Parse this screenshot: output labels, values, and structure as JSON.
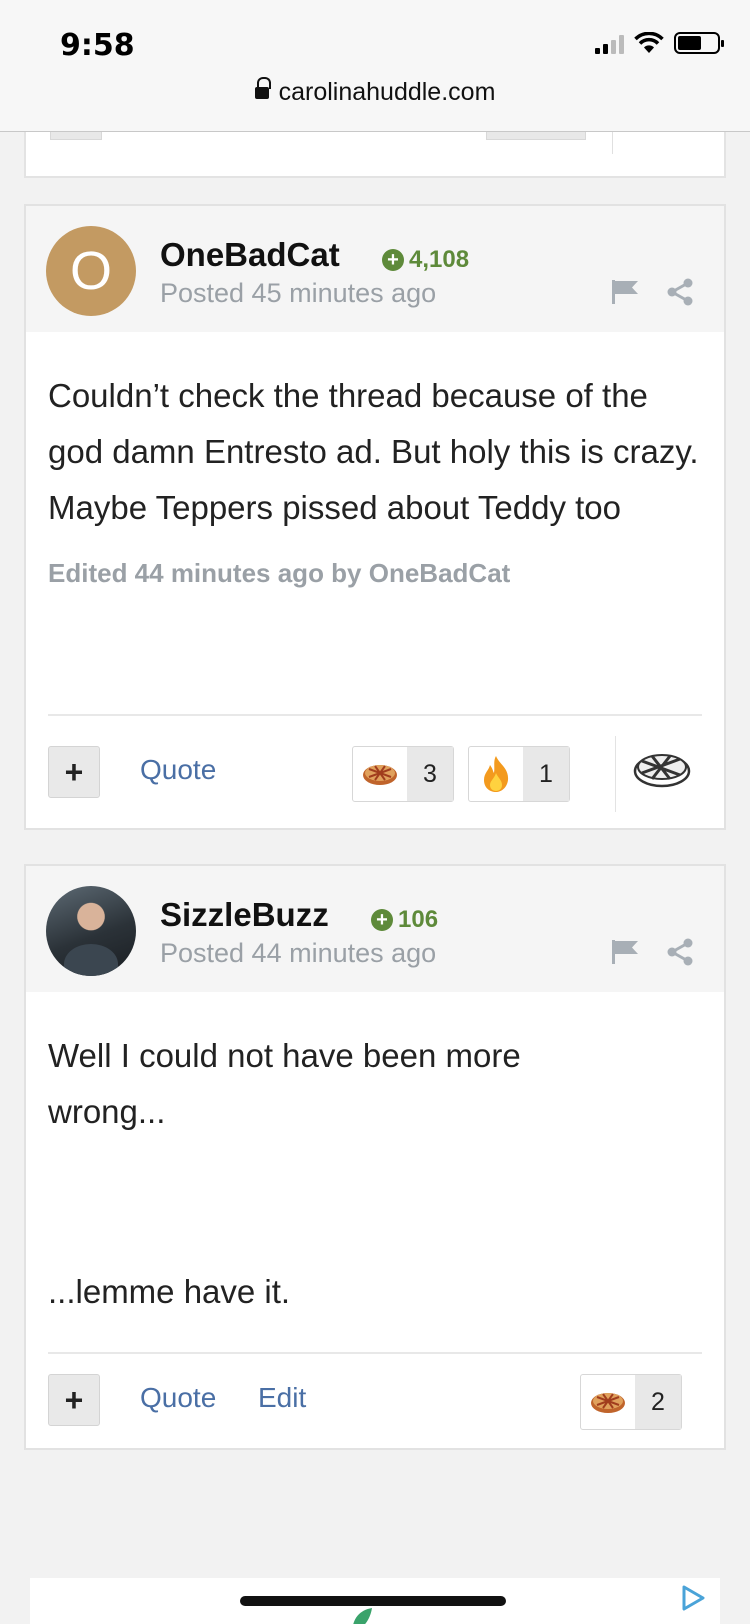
{
  "status_bar": {
    "time": "9:58"
  },
  "browser": {
    "url": "carolinahuddle.com"
  },
  "posts": [
    {
      "author": "OneBadCat",
      "avatar_letter": "O",
      "reputation": "4,108",
      "posted": "Posted 45 minutes ago",
      "body": "Couldn’t check the thread because of the god damn Entresto ad. But holy this is crazy. Maybe Teppers pissed about Teddy too",
      "edited": "Edited 44 minutes ago by OneBadCat",
      "actions": {
        "quote": "Quote"
      },
      "reactions": [
        {
          "icon": "pie-icon",
          "count": "3"
        },
        {
          "icon": "fire-icon",
          "count": "1"
        }
      ]
    },
    {
      "author": "SizzleBuzz",
      "reputation": "106",
      "posted": "Posted 44 minutes ago",
      "body_lines": [
        "Well I could not have been more",
        "wrong...",
        "",
        "",
        "...lemme have it."
      ],
      "actions": {
        "quote": "Quote",
        "edit": "Edit"
      },
      "reactions": [
        {
          "icon": "pie-icon",
          "count": "2"
        }
      ]
    }
  ],
  "colors": {
    "reputation": "#5e8a3a",
    "link": "#4a6fa5",
    "muted": "#9aa0a6"
  }
}
